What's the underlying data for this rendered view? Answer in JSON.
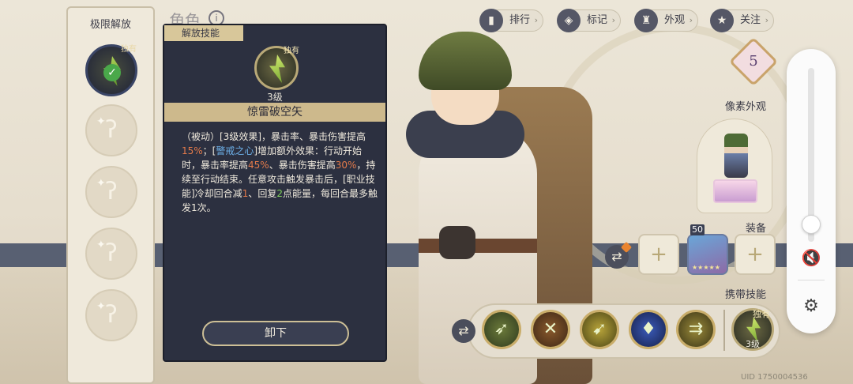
{
  "header": {
    "page_title": "角色",
    "info_icon": "i"
  },
  "limit_panel": {
    "title": "极限解放",
    "active_slot": {
      "exclusive_label": "独有",
      "check": "✓"
    },
    "locked_slot_icon": "wand-icon"
  },
  "skill_card": {
    "header_label": "解放技能",
    "exclusive_label": "独有",
    "level": "3级",
    "name": "惊雷破空矢",
    "desc": {
      "p1": "（被动）[3级效果]，暴击率、暴击伤害提高",
      "v1": "15%",
      "p2": "；[",
      "v2": "警戒之心",
      "p3": "]增加额外效果：行动开始时，暴击率提高",
      "v3": "45%",
      "p4": "、暴击伤害提高",
      "v4": "30%",
      "p5": "，持续至行动结束。任意攻击触发暴击后，[职业技能]冷却回合减",
      "v5": "1",
      "p6": "、回复",
      "v6": "2",
      "p7": "点能量，每回合最多触发1次。"
    },
    "unequip_label": "卸下"
  },
  "top_buttons": [
    {
      "label": "排行",
      "icon": "ranking-icon",
      "glyph": "▮"
    },
    {
      "label": "标记",
      "icon": "tag-icon",
      "glyph": "◈"
    },
    {
      "label": "外观",
      "icon": "outfit-icon",
      "glyph": "♜"
    },
    {
      "label": "关注",
      "icon": "star-icon",
      "glyph": "★"
    }
  ],
  "star_level": "5",
  "pixel_section_label": "像素外观",
  "equipment": {
    "label": "装备",
    "item_level": "50",
    "item_stars": "★★★★★",
    "slot_glyph": "+"
  },
  "carried_skills": {
    "label": "携带技能",
    "skills": [
      {
        "icon": "arrow-volley-icon",
        "glyph": "➶",
        "colors": [
          "#6b7a3a",
          "#2f3a1e"
        ]
      },
      {
        "icon": "crossbow-icon",
        "glyph": "✕",
        "colors": [
          "#8a5a2c",
          "#3c2616"
        ]
      },
      {
        "icon": "bow-shot-icon",
        "glyph": "➹",
        "colors": [
          "#b8a43a",
          "#4a4416"
        ]
      },
      {
        "icon": "buff-silhouette-icon",
        "glyph": "♦",
        "colors": [
          "#3a5ab8",
          "#16204a"
        ]
      },
      {
        "icon": "triple-arrow-icon",
        "glyph": "⇉",
        "colors": [
          "#9a8a3a",
          "#3a3416"
        ]
      }
    ],
    "exclusive": {
      "label": "独有",
      "level": "3级"
    }
  },
  "uid": "UID 1750004536",
  "system": {
    "mute_icon": "🔇",
    "settings_icon": "⚙"
  }
}
